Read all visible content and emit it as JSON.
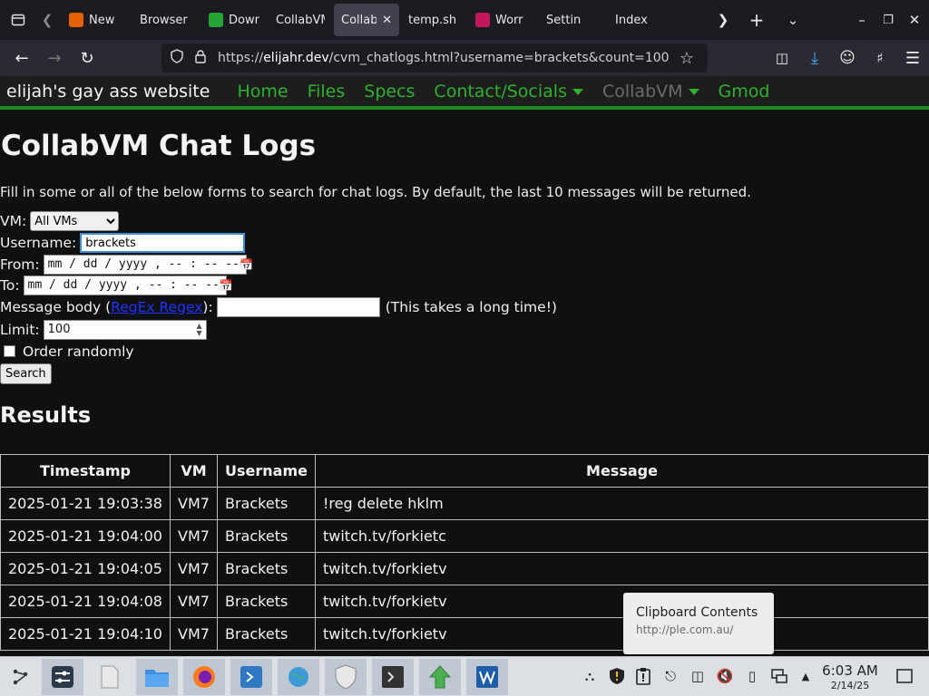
{
  "browser": {
    "tabs": [
      {
        "label": "New",
        "color": "#e66000"
      },
      {
        "label": "Browser",
        "color": ""
      },
      {
        "label": "Down",
        "color": "#25a537"
      },
      {
        "label": "CollabVM",
        "color": ""
      },
      {
        "label": "Collab",
        "color": ""
      },
      {
        "label": "temp.sh",
        "color": ""
      },
      {
        "label": "Worr",
        "color": "#c2185b"
      },
      {
        "label": "Settin",
        "color": ""
      },
      {
        "label": "Index",
        "color": ""
      }
    ],
    "url_prefix": "https://",
    "url_host": "elijahr.dev",
    "url_rest": "/cvm_chatlogs.html?username=brackets&count=100"
  },
  "site": {
    "title": "elijah's gay ass website",
    "nav": [
      "Home",
      "Files",
      "Specs",
      "Contact/Socials",
      "CollabVM",
      "Gmod"
    ]
  },
  "page": {
    "heading": "CollabVM Chat Logs",
    "intro": "Fill in some or all of the below forms to search for chat logs. By default, the last 10 messages will be returned.",
    "form": {
      "vm_label": "VM:",
      "vm_value": "All VMs",
      "username_label": "Username:",
      "username_value": "brackets",
      "from_label": "From:",
      "to_label": "To:",
      "datetime_placeholder": "mm / dd / yyyy ,  -- : --  --",
      "message_label_start": "Message body (",
      "message_link": "RegEx Regex",
      "message_label_end": "):",
      "message_note": "(This takes a long time!)",
      "limit_label": "Limit:",
      "limit_value": "100",
      "order_label": "Order randomly",
      "search_label": "Search"
    },
    "results_heading": "Results",
    "table": {
      "headers": [
        "Timestamp",
        "VM",
        "Username",
        "Message"
      ],
      "rows": [
        [
          "2025-01-21 19:03:38",
          "VM7",
          "Brackets",
          "!reg delete hklm"
        ],
        [
          "2025-01-21 19:04:00",
          "VM7",
          "Brackets",
          "twitch.tv/forkietc"
        ],
        [
          "2025-01-21 19:04:05",
          "VM7",
          "Brackets",
          "twitch.tv/forkietv"
        ],
        [
          "2025-01-21 19:04:08",
          "VM7",
          "Brackets",
          "twitch.tv/forkietv"
        ],
        [
          "2025-01-21 19:04:10",
          "VM7",
          "Brackets",
          "twitch.tv/forkietv"
        ]
      ]
    }
  },
  "notification": {
    "title": "Clipboard Contents",
    "body": "http://ple.com.au/"
  },
  "taskbar": {
    "time": "6:03 AM",
    "date": "2/14/25"
  }
}
